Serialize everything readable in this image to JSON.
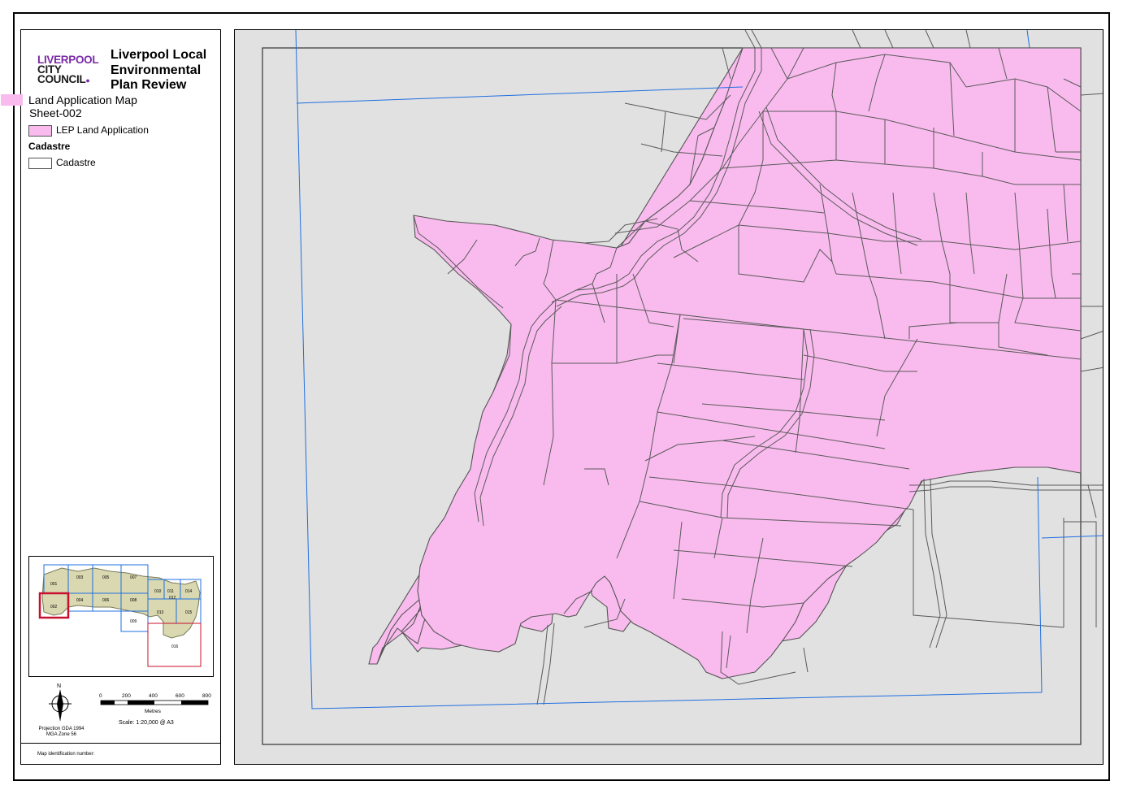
{
  "legend": {
    "logo_line1": "LIVERPOOL",
    "logo_line2": "CITY",
    "logo_line3": "COUNCIL",
    "title": "Liverpool Local Environmental Plan Review",
    "subtitle": "Land Application Map",
    "sheet": "Sheet-002",
    "items": [
      {
        "label": "LEP Land Application",
        "color": "#f9bbee"
      }
    ],
    "cadastre_heading": "Cadastre",
    "cadastre_label": "Cadastre",
    "projection_line1": "Projection GDA 1994",
    "projection_line2": "MGA Zone 56",
    "north_label": "N",
    "scale_ticks": [
      "0",
      "200",
      "400",
      "600",
      "800"
    ],
    "scale_units": "Metres",
    "scale_text": "Scale: 1:20,000 @ A3",
    "map_id_label": "Map identification number:"
  },
  "inset": {
    "sheets": [
      "001",
      "002",
      "003",
      "004",
      "005",
      "006",
      "007",
      "008",
      "009",
      "010",
      "011",
      "012",
      "013",
      "014",
      "015",
      "016"
    ],
    "highlighted_sheet": "002"
  },
  "colors": {
    "land": "#f9bbee",
    "background": "#e1e1e1",
    "sheet_grid": "#1f6fe0",
    "inset_land": "#d9d8b0",
    "inset_highlight": "#c8102e"
  }
}
